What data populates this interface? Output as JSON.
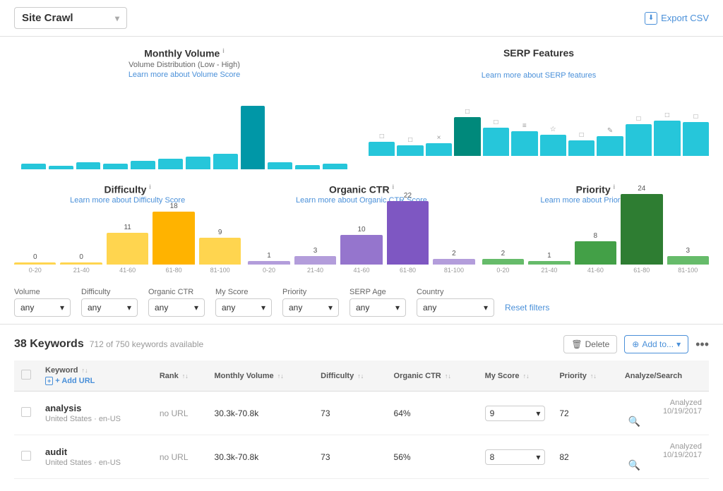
{
  "header": {
    "site_crawl_label": "Site Crawl",
    "export_csv_label": "Export CSV"
  },
  "monthly_volume": {
    "title": "Monthly Volume",
    "info": "i",
    "subtitle": "Volume Distribution (Low - High)",
    "link": "Learn more about Volume Score",
    "bars": [
      {
        "height": 8,
        "label": "",
        "color": "#26c6da"
      },
      {
        "height": 5,
        "label": "",
        "color": "#26c6da"
      },
      {
        "height": 10,
        "label": "",
        "color": "#26c6da"
      },
      {
        "height": 8,
        "label": "",
        "color": "#26c6da"
      },
      {
        "height": 12,
        "label": "",
        "color": "#26c6da"
      },
      {
        "height": 15,
        "label": "",
        "color": "#26c6da"
      },
      {
        "height": 18,
        "label": "",
        "color": "#26c6da"
      },
      {
        "height": 22,
        "label": "",
        "color": "#26c6da"
      },
      {
        "height": 90,
        "label": "",
        "color": "#0097a7"
      },
      {
        "height": 10,
        "label": "",
        "color": "#26c6da"
      },
      {
        "height": 6,
        "label": "",
        "color": "#26c6da"
      },
      {
        "height": 8,
        "label": "",
        "color": "#26c6da"
      }
    ]
  },
  "serp_features": {
    "title": "SERP Features",
    "link": "Learn more about SERP features",
    "bars": [
      {
        "height": 20,
        "color": "#26c6da",
        "icon": "□"
      },
      {
        "height": 15,
        "color": "#26c6da",
        "icon": "□"
      },
      {
        "height": 18,
        "color": "#26c6da",
        "icon": "×"
      },
      {
        "height": 55,
        "color": "#00897b",
        "icon": "□"
      },
      {
        "height": 40,
        "color": "#26c6da",
        "icon": "□"
      },
      {
        "height": 35,
        "color": "#26c6da",
        "icon": "≡"
      },
      {
        "height": 30,
        "color": "#26c6da",
        "icon": "☆"
      },
      {
        "height": 22,
        "color": "#26c6da",
        "icon": "□"
      },
      {
        "height": 28,
        "color": "#26c6da",
        "icon": "✎"
      },
      {
        "height": 45,
        "color": "#26c6da",
        "icon": "□"
      },
      {
        "height": 50,
        "color": "#26c6da",
        "icon": "□"
      },
      {
        "height": 48,
        "color": "#26c6da",
        "icon": "□"
      }
    ]
  },
  "difficulty": {
    "title": "Difficulty",
    "link": "Learn more about Difficulty Score",
    "bars": [
      {
        "value": 0,
        "height": 2,
        "label": "0-20",
        "color": "#ffd54f"
      },
      {
        "value": 0,
        "height": 2,
        "label": "21-40",
        "color": "#ffd54f"
      },
      {
        "value": 11,
        "height": 45,
        "label": "41-60",
        "color": "#ffd54f"
      },
      {
        "value": 18,
        "height": 75,
        "label": "61-80",
        "color": "#ffb300"
      },
      {
        "value": 9,
        "height": 38,
        "label": "81-100",
        "color": "#ffd54f"
      }
    ]
  },
  "organic_ctr": {
    "title": "Organic CTR",
    "link": "Learn more about Organic CTR Score",
    "bars": [
      {
        "value": 1,
        "height": 5,
        "label": "0-20",
        "color": "#b39ddb"
      },
      {
        "value": 3,
        "height": 12,
        "label": "21-40",
        "color": "#b39ddb"
      },
      {
        "value": 10,
        "height": 42,
        "label": "41-60",
        "color": "#9575cd"
      },
      {
        "value": 22,
        "height": 90,
        "label": "61-80",
        "color": "#7e57c2"
      },
      {
        "value": 2,
        "height": 8,
        "label": "81-100",
        "color": "#b39ddb"
      }
    ]
  },
  "priority": {
    "title": "Priority",
    "link": "Learn more about Priority Score",
    "bars": [
      {
        "value": 2,
        "height": 8,
        "label": "0-20",
        "color": "#66bb6a"
      },
      {
        "value": 1,
        "height": 5,
        "label": "21-40",
        "color": "#66bb6a"
      },
      {
        "value": 8,
        "height": 33,
        "label": "41-60",
        "color": "#43a047"
      },
      {
        "value": 24,
        "height": 100,
        "label": "61-80",
        "color": "#2e7d32"
      },
      {
        "value": 3,
        "height": 12,
        "label": "81-100",
        "color": "#66bb6a"
      }
    ]
  },
  "filters": {
    "volume": {
      "label": "Volume",
      "value": "any"
    },
    "difficulty": {
      "label": "Difficulty",
      "value": "any"
    },
    "organic_ctr": {
      "label": "Organic CTR",
      "value": "any"
    },
    "my_score": {
      "label": "My Score",
      "value": "any"
    },
    "priority": {
      "label": "Priority",
      "value": "any"
    },
    "serp_age": {
      "label": "SERP Age",
      "value": "any"
    },
    "country": {
      "label": "Country",
      "value": "any"
    },
    "reset": "Reset filters"
  },
  "keywords_section": {
    "count": "38 Keywords",
    "available": "712 of 750 keywords available",
    "delete_label": "Delete",
    "add_to_label": "Add to...",
    "columns": {
      "keyword": "Keyword",
      "rank": "Rank",
      "add_url": "+ Add URL",
      "monthly_volume": "Monthly Volume",
      "difficulty": "Difficulty",
      "organic_ctr": "Organic CTR",
      "my_score": "My Score",
      "priority": "Priority",
      "analyze_search": "Analyze/Search"
    },
    "rows": [
      {
        "keyword": "analysis",
        "locale": "United States · en-US",
        "rank": "no URL",
        "monthly_volume": "30.3k-70.8k",
        "difficulty": "73",
        "organic_ctr": "64%",
        "my_score": "9",
        "priority": "72",
        "analyzed": "Analyzed",
        "date": "10/19/2017"
      },
      {
        "keyword": "audit",
        "locale": "United States · en-US",
        "rank": "no URL",
        "monthly_volume": "30.3k-70.8k",
        "difficulty": "73",
        "organic_ctr": "56%",
        "my_score": "8",
        "priority": "82",
        "analyzed": "Analyzed",
        "date": "10/19/2017"
      }
    ]
  }
}
